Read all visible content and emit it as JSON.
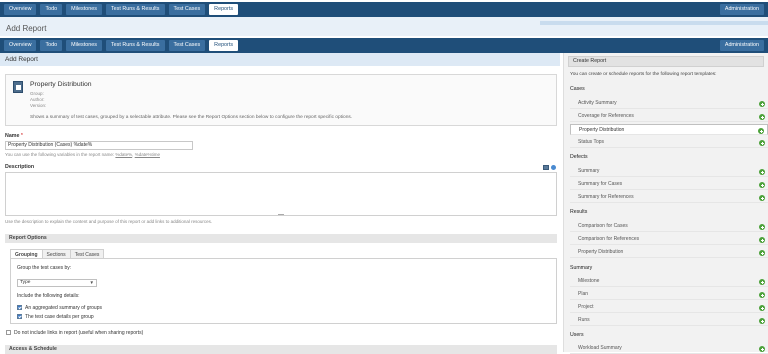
{
  "nav": {
    "tabs": [
      "Overview",
      "Todo",
      "Milestones",
      "Test Runs & Results",
      "Test Cases",
      "Reports"
    ],
    "active": "Reports",
    "admin": "Administration"
  },
  "ghost_title": "Add Report",
  "page_title": "Add Report",
  "template": {
    "title": "Property Distribution",
    "group_label": "Group:",
    "author_label": "Author:",
    "version_label": "Version:",
    "description": "Shows a summary of test cases, grouped by a selectable attribute. Please see the Report Options section below to configure the report specific options."
  },
  "name": {
    "label": "Name",
    "required_mark": "*",
    "value": "Property Distribution (Cases) %date%",
    "hint_prefix": "You can use the following variables in the report name: ",
    "hint_var1": "%date%",
    "hint_sep": ", ",
    "hint_var2": "%date%time"
  },
  "description": {
    "label": "Description",
    "hint": "Use the description to explain the content and purpose of this report or add links to additional resources."
  },
  "report_options": {
    "header": "Report Options",
    "tabs": [
      "Grouping",
      "Sections",
      "Test Cases"
    ],
    "group_by_label": "Group the test cases by:",
    "group_by_value": "Type",
    "include_label": "Include the following details:",
    "opt_summary": "An aggregated summary of groups",
    "opt_details": "The test case details per group",
    "opt_summary_checked": true,
    "opt_details_checked": true
  },
  "no_links": {
    "label": "Do not include links in report (useful when sharing reports)",
    "checked": false
  },
  "next_section": "Access & Schedule",
  "sidebar": {
    "header": "Create Report",
    "intro": "You can create or schedule reports for the following report templates:",
    "groups": [
      {
        "title": "Cases",
        "items": [
          "Activity Summary",
          "Coverage for References",
          "Property Distribution",
          "Status Tops"
        ]
      },
      {
        "title": "Defects",
        "items": [
          "Summary",
          "Summary for Cases",
          "Summary for References"
        ]
      },
      {
        "title": "Results",
        "items": [
          "Comparison for Cases",
          "Comparison for References",
          "Property Distribution"
        ]
      },
      {
        "title": "Summary",
        "items": [
          "Milestone",
          "Plan",
          "Project",
          "Runs"
        ]
      },
      {
        "title": "Users",
        "items": [
          "Workload Summary"
        ]
      }
    ],
    "selected": "Property Distribution"
  },
  "colors": {
    "nav": "#1f4e79",
    "accent": "#4ca13a",
    "page_title_bg": "#dde9f5"
  }
}
